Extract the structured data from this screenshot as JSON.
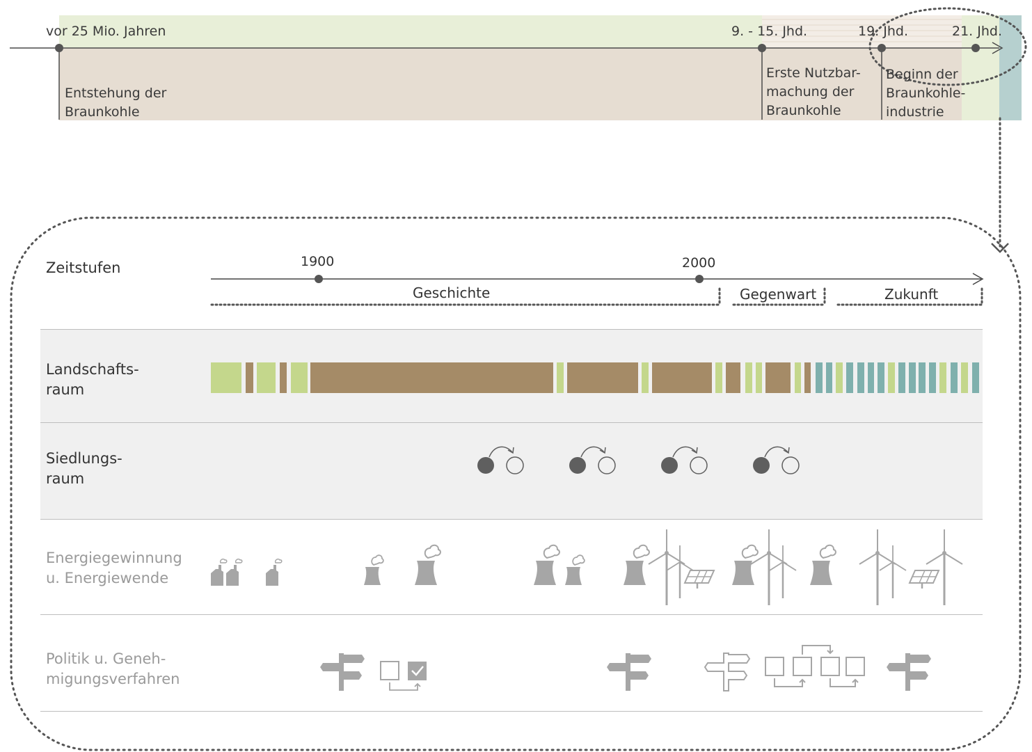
{
  "overview": {
    "labels": [
      {
        "id": "start",
        "text": "vor 25 Mio. Jahren"
      },
      {
        "id": "medieval",
        "text": "9. - 15. Jhd."
      },
      {
        "id": "c19",
        "text": "19. Jhd."
      },
      {
        "id": "c21",
        "text": "21. Jhd."
      }
    ],
    "events": [
      {
        "id": "origin",
        "text": "Entstehung der\nBraunkohle"
      },
      {
        "id": "first-use",
        "text": "Erste Nutzbar-\nmachung der\nBraunkohle"
      },
      {
        "id": "industry",
        "text": "Beginn der\nBraunkohle-\nindustrie"
      }
    ],
    "colors": {
      "green": "#e8efd8",
      "brown": "#e6ddd2",
      "teal": "#b6d0cf"
    }
  },
  "detail": {
    "timeline": {
      "row_label": "Zeitstufen",
      "years": [
        "1900",
        "2000"
      ],
      "phases": [
        "Geschichte",
        "Gegenwart",
        "Zukunft"
      ]
    },
    "rows": [
      {
        "id": "landscape",
        "label": "Landschafts-\nraum"
      },
      {
        "id": "settlement",
        "label": "Siedlungs-\nraum"
      },
      {
        "id": "energy",
        "label": "Energiegewinnung\nu. Energiewende"
      },
      {
        "id": "politics",
        "label": "Politik u. Geneh-\nmigungsverfahren"
      }
    ],
    "landscape_colors": {
      "green": "#c4d78c",
      "brown": "#a58b67",
      "teal": "#7fb0ad"
    },
    "icon_color": "#a6a6a6"
  }
}
